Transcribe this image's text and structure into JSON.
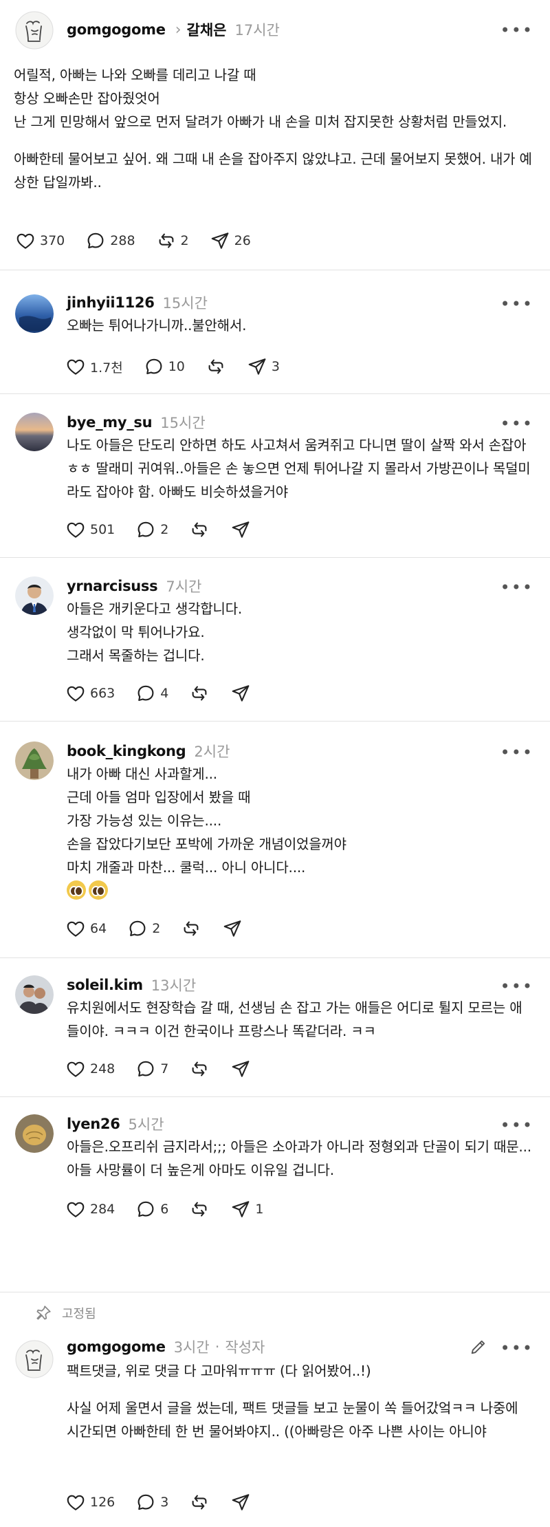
{
  "root_post": {
    "username": "gomgogome",
    "reply_to": "갈채은",
    "time": "17시간",
    "lines": [
      "어릴적, 아빠는 나와 오빠를 데리고 나갈 때",
      "항상 오빠손만 잡아줬엇어",
      "난 그게 민망해서 앞으로 먼저 달려가 아빠가 내 손을 미처 잡지못한 상황처럼 만들었지."
    ],
    "lines2": [
      "아빠한테 물어보고 싶어. 왜 그때 내 손을 잡아주지 않았냐고. 근데 물어보지 못했어. 내가 예상한 답일까봐.."
    ],
    "likes": "370",
    "comments": "288",
    "reposts": "2",
    "shares": "26"
  },
  "replies": [
    {
      "username": "jinhyii1126",
      "time": "15시간",
      "text": "오빠는 튀어나가니까..불안해서.",
      "likes": "1.7천",
      "comments": "10",
      "reposts": "",
      "shares": "3"
    },
    {
      "username": "bye_my_su",
      "time": "15시간",
      "text": "나도 아들은 단도리 안하면 하도 사고쳐서 움켜쥐고 다니면 딸이 살짝 와서 손잡아 ㅎㅎ 딸래미 귀여워..아들은 손 놓으면 언제 튀어나갈 지 몰라서 가방끈이나 목덜미라도 잡아야 함. 아빠도 비슷하셨을거야",
      "likes": "501",
      "comments": "2",
      "reposts": "",
      "shares": ""
    },
    {
      "username": "yrnarcisuss",
      "time": "7시간",
      "text_lines": [
        "아들은 개키운다고 생각합니다.",
        "생각없이 막 튀어나가요.",
        "그래서 목줄하는 겁니다."
      ],
      "likes": "663",
      "comments": "4",
      "reposts": "",
      "shares": ""
    },
    {
      "username": "book_kingkong",
      "time": "2시간",
      "text_lines": [
        "내가 아빠 대신 사과할게...",
        "근데 아들 엄마 입장에서 봤을 때",
        "가장 가능성 있는 이유는....",
        "손을 잡았다기보단 포박에 가까운 개념이었을꺼야",
        "마치 개줄과 마찬... 쿨럭... 아니 아니다...."
      ],
      "likes": "64",
      "comments": "2",
      "reposts": "",
      "shares": ""
    },
    {
      "username": "soleil.kim",
      "time": "13시간",
      "text": "유치원에서도 현장학습 갈 때, 선생님 손 잡고 가는 애들은 어디로 튈지 모르는 애들이야. ㅋㅋㅋ 이건 한국이나 프랑스나 똑같더라. ㅋㅋ",
      "likes": "248",
      "comments": "7",
      "reposts": "",
      "shares": ""
    },
    {
      "username": "lyen26",
      "time": "5시간",
      "text": "아들은.오프리쉬 금지라서;;; 아들은 소아과가 아니라 정형외과 단골이 되기 때문...아들 사망률이 더 높은게 아마도 이유일 겁니다.",
      "likes": "284",
      "comments": "6",
      "reposts": "",
      "shares": "1"
    }
  ],
  "pinned": {
    "label": "고정됨",
    "username": "gomgogome",
    "time": "3시간",
    "author_tag": "작성자",
    "line1": "팩트댓글, 위로 댓글 다 고마워ㅠㅠㅠ (다 읽어봤어..!)",
    "line2": "사실 어제 울면서 글을 썼는데, 팩트 댓글들 보고 눈물이 쏙 들어갔엌ㅋㅋ 나중에 시간되면 아빠한테 한 번 물어봐야지.. ((아빠랑은 아주 나쁜 사이는 아니야",
    "likes": "126",
    "comments": "3"
  },
  "icons": {
    "like": "heart-outline-icon",
    "comment": "speech-bubble-icon",
    "repost": "repost-arrows-icon",
    "share": "paper-plane-icon",
    "more": "more-dots-icon",
    "pin": "pin-icon",
    "edit": "pencil-icon"
  },
  "colors": {
    "text": "#111111",
    "muted": "#9a9a9a",
    "divider": "#e2e2e2"
  }
}
